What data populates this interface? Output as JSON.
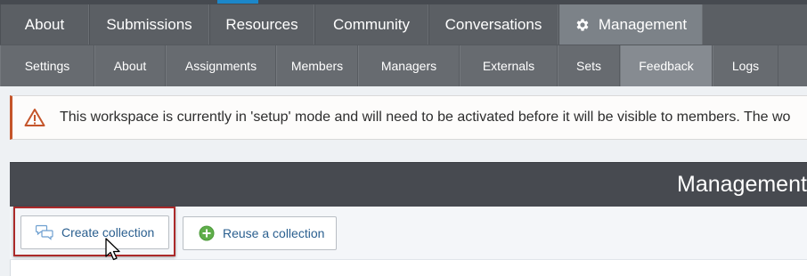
{
  "primary_nav": {
    "items": [
      {
        "label": "About",
        "width": 100
      },
      {
        "label": "Submissions",
        "width": 135
      },
      {
        "label": "Resources",
        "width": 118
      },
      {
        "label": "Community",
        "width": 128
      },
      {
        "label": "Conversations",
        "width": 146
      },
      {
        "label": "Management",
        "width": 162,
        "active": true,
        "icon": "gear-icon"
      }
    ]
  },
  "secondary_nav": {
    "items": [
      {
        "label": "Settings",
        "width": 106
      },
      {
        "label": "About",
        "width": 80
      },
      {
        "label": "Assignments",
        "width": 124
      },
      {
        "label": "Members",
        "width": 92
      },
      {
        "label": "Managers",
        "width": 114
      },
      {
        "label": "Externals",
        "width": 110
      },
      {
        "label": "Sets",
        "width": 70
      },
      {
        "label": "Feedback",
        "width": 104,
        "active": true
      },
      {
        "label": "Logs",
        "width": 74
      }
    ]
  },
  "alert": {
    "icon": "warning-icon",
    "text": "This workspace is currently in 'setup' mode and will need to be activated before it will be visible to members. The wo"
  },
  "panel": {
    "title": "Management"
  },
  "toolbar": {
    "create_label": "Create collection",
    "create_icon": "speech-bubbles-icon",
    "reuse_label": "Reuse a collection",
    "reuse_icon": "plus-circle-icon"
  },
  "colors": {
    "primary_nav_bg": "#5b5f64",
    "secondary_nav_bg": "#676b70",
    "active_tab_bg": "#7c8288",
    "alert_accent": "#c5552a",
    "panel_header_bg": "#474a50",
    "button_text": "#2a5f8f",
    "highlight_border": "#ab2a2a",
    "add_icon_green": "#5fae4a"
  }
}
